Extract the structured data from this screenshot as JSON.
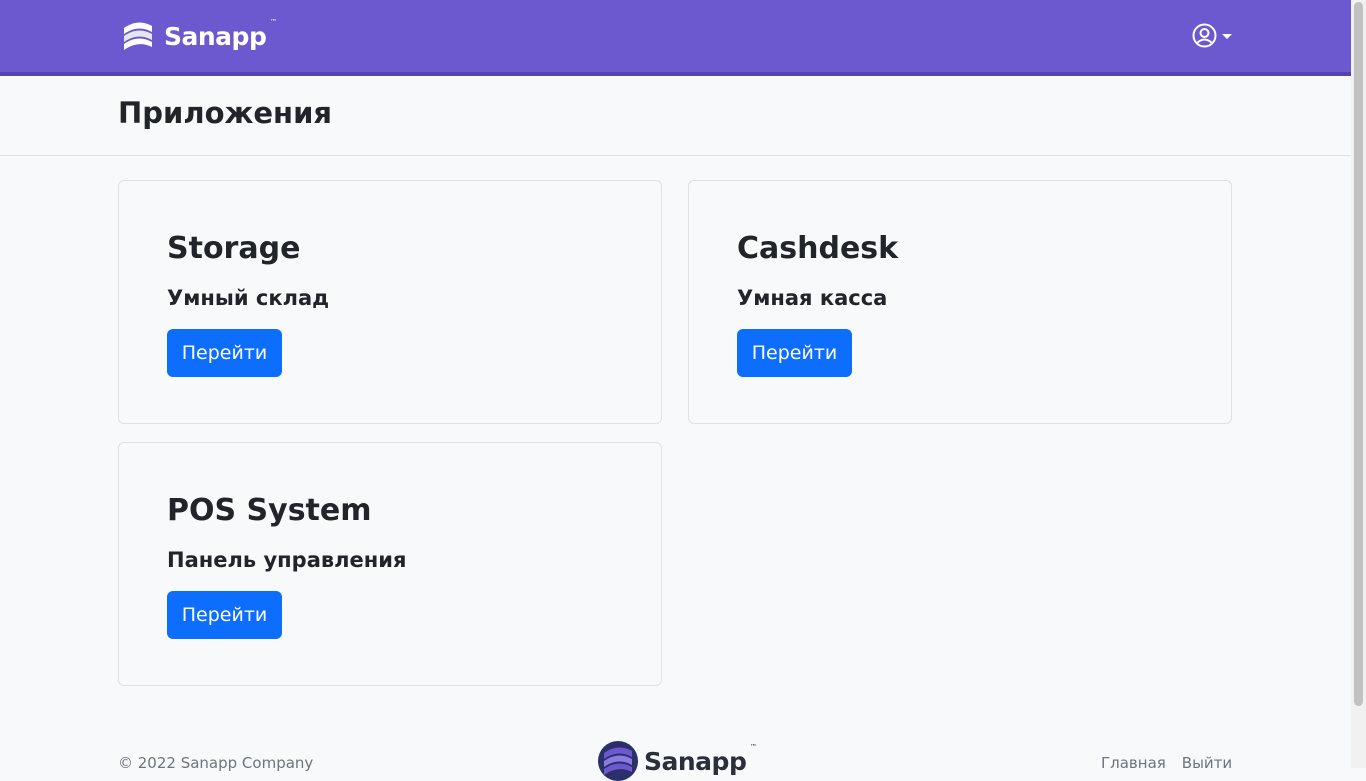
{
  "header": {
    "brand": "Sanapp",
    "trademark": "™",
    "user_icon": "user-circle-icon",
    "caret_icon": "caret-down-icon"
  },
  "page": {
    "title": "Приложения"
  },
  "cards": [
    {
      "name": "Storage",
      "description": "Умный склад",
      "button": "Перейти"
    },
    {
      "name": "Cashdesk",
      "description": "Умная касса",
      "button": "Перейти"
    },
    {
      "name": "POS System",
      "description": "Панель управления",
      "button": "Перейти"
    }
  ],
  "footer": {
    "copyright": "© 2022 Sanapp Company",
    "brand": "Sanapp",
    "trademark": "™",
    "links": [
      "Главная",
      "Выйти"
    ]
  },
  "colors": {
    "navbar": "#6c59d0",
    "primary_button": "#0d6efd",
    "background": "#f8f9fa"
  }
}
